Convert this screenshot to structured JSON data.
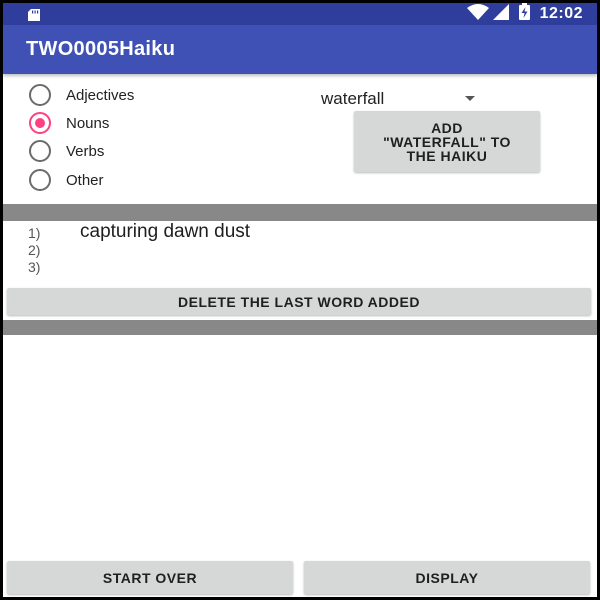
{
  "status_bar": {
    "time": "12:02",
    "icons": [
      "sd-card-icon",
      "wifi-icon",
      "signal-icon",
      "battery-charging-icon"
    ]
  },
  "app_bar": {
    "title": "TWO0005Haiku"
  },
  "word_types": {
    "options": [
      {
        "label": "Adjectives",
        "checked": false
      },
      {
        "label": "Nouns",
        "checked": true
      },
      {
        "label": "Verbs",
        "checked": false
      },
      {
        "label": "Other",
        "checked": false
      }
    ]
  },
  "word_spinner": {
    "selected": "waterfall"
  },
  "add_button": {
    "label": "ADD\n\"WATERFALL\" TO\nTHE HAIKU"
  },
  "haiku": {
    "lines": [
      {
        "number": "1)",
        "text": "capturing dawn dust"
      },
      {
        "number": "2)",
        "text": ""
      },
      {
        "number": "3)",
        "text": ""
      }
    ]
  },
  "delete_button": {
    "label": "DELETE THE LAST WORD ADDED"
  },
  "footer": {
    "start_over_label": "START OVER",
    "display_label": "DISPLAY"
  },
  "colors": {
    "status_bar": "#2f3d9c",
    "app_bar": "#3f51b5",
    "accent": "#ff4081",
    "button": "#d6d7d7",
    "divider": "#888888"
  }
}
